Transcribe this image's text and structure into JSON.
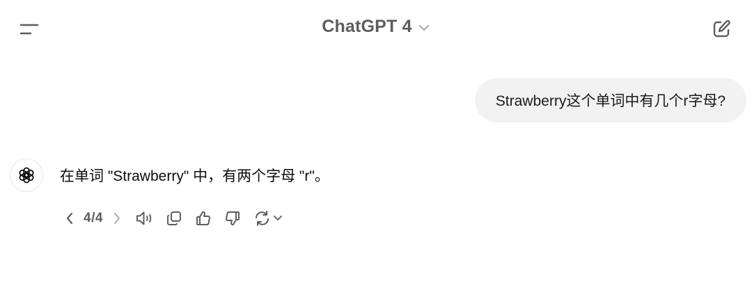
{
  "header": {
    "title": "ChatGPT 4",
    "icons": {
      "menu": "menu-icon",
      "model_dropdown": "chevron-down-icon",
      "new_chat": "new-chat-icon"
    }
  },
  "conversation": {
    "user_message": "Strawberry这个单词中有几个r字母?",
    "assistant_message": "在单词 \"Strawberry\" 中，有两个字母 \"r\"。"
  },
  "toolbar": {
    "pager": "4/4",
    "icons": [
      "chevron-left-icon",
      "chevron-right-icon",
      "speaker-icon",
      "copy-icon",
      "thumbs-up-icon",
      "thumbs-down-icon",
      "regenerate-icon",
      "chevron-down-icon"
    ]
  },
  "colors": {
    "background": "#ffffff",
    "bubble": "#f2f2f2",
    "muted_text": "#5d5d5d",
    "icon": "#5d5d5d"
  }
}
